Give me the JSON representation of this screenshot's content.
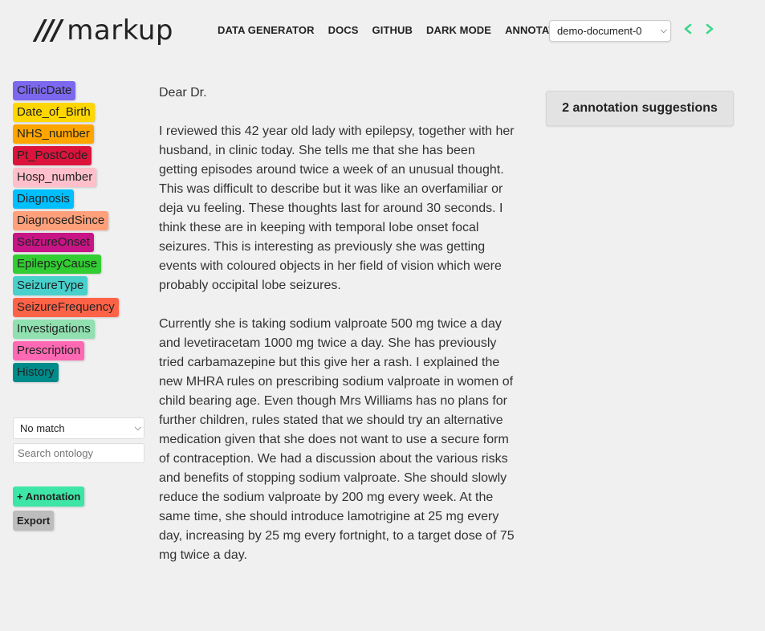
{
  "header": {
    "logo_slashes": "///",
    "logo_text": "markup",
    "nav": [
      "DATA GENERATOR",
      "DOCS",
      "GITHUB",
      "DARK MODE",
      "ANNOTATE"
    ],
    "document_select": "demo-document-0"
  },
  "sidebar": {
    "labels": [
      {
        "text": "ClinicDate",
        "color": "#7b68ee"
      },
      {
        "text": "Date_of_Birth",
        "color": "#ffd700"
      },
      {
        "text": "NHS_number",
        "color": "#ffa500"
      },
      {
        "text": "Pt_PostCode",
        "color": "#dc143c"
      },
      {
        "text": "Hosp_number",
        "color": "#ffc0cb"
      },
      {
        "text": "Diagnosis",
        "color": "#00bfff"
      },
      {
        "text": "DiagnosedSince",
        "color": "#ffa07a"
      },
      {
        "text": "SeizureOnset",
        "color": "#c71585"
      },
      {
        "text": "EpilepsyCause",
        "color": "#32cd32"
      },
      {
        "text": "SeizureType",
        "color": "#48d1cc"
      },
      {
        "text": "SeizureFrequency",
        "color": "#ff6347"
      },
      {
        "text": "Investigations",
        "color": "#90e0b0"
      },
      {
        "text": "Prescription",
        "color": "#ff69b4"
      },
      {
        "text": "History",
        "color": "#008b8b"
      }
    ],
    "match_select": "No match",
    "search_placeholder": "Search ontology",
    "add_annotation": "+ Annotation",
    "export": "Export"
  },
  "document": {
    "paragraphs": [
      "Dear Dr.",
      "I reviewed this 42 year old lady with epilepsy, together with her husband, in clinic today. She tells me that she has been getting episodes around twice a week of an unusual thought. This was difficult to describe but it was like an overfamiliar or deja vu feeling. These thoughts last for around 30 seconds. I think these are in keeping with temporal lobe onset focal seizures. This is interesting as previously she was getting events with coloured objects in her field of vision which were probably occipital lobe seizures.",
      "Currently she is taking sodium valproate 500 mg twice a day and levetiracetam 1000 mg twice a day. She has previously tried carbamazepine but this give her a rash. I explained the new MHRA rules on prescribing sodium valproate in women of child bearing age. Even though Mrs Williams has no plans for further children, rules stated that we should try an alternative medication given that she does not want to use a secure form of contraception. We had a discussion about the various risks and benefits of stopping sodium valproate. She should slowly reduce the sodium valproate by 200 mg every week. At the same time, she should introduce lamotrigine at 25 mg every day, increasing by 25 mg every fortnight, to a target dose of 75 mg twice a day."
    ]
  },
  "suggestions": {
    "label": "2 annotation suggestions"
  }
}
